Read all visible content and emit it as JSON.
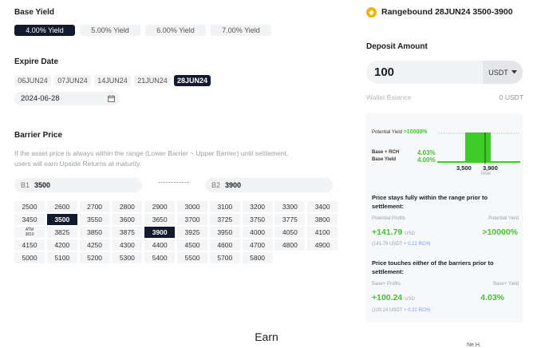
{
  "base_yield": {
    "title": "Base Yield",
    "options": [
      "4.00% Yield",
      "5.00% Yield",
      "6.00% Yield",
      "7.00% Yield"
    ],
    "selected": 0
  },
  "expire": {
    "title": "Expire Date",
    "dates": [
      "06JUN24",
      "07JUN24",
      "14JUN24",
      "21JUN24",
      "28JUN24"
    ],
    "selected": 4,
    "date_value": "2024-06-28"
  },
  "barrier": {
    "title": "Barrier Price",
    "description_1": "If the asset price is always within the range (Lower Barrier ~ Upper Barrier) until settlement,",
    "description_2": "users will earn Upside Returns at maturity.",
    "b1_label": "B1",
    "b1_value": "3500",
    "b2_label": "B2",
    "b2_value": "3900",
    "atm_label": "ATM",
    "atm_value": "3810",
    "prices": [
      "2500",
      "2600",
      "2700",
      "2800",
      "2900",
      "3000",
      "3100",
      "3200",
      "3300",
      "3400",
      "3450",
      "3500",
      "3550",
      "3600",
      "3650",
      "3700",
      "3725",
      "3750",
      "3775",
      "3800",
      "ATM",
      "3825",
      "3850",
      "3875",
      "3900",
      "3925",
      "3950",
      "4000",
      "4050",
      "4100",
      "4150",
      "4200",
      "4250",
      "4300",
      "4400",
      "4500",
      "4600",
      "4700",
      "4800",
      "4900",
      "5000",
      "5100",
      "5200",
      "5300",
      "5400",
      "5500",
      "5700",
      "5800",
      "",
      ""
    ],
    "selected": [
      "3500",
      "3900"
    ]
  },
  "footer": {
    "earn": "Earn",
    "corner": "Ne.H."
  },
  "product": {
    "title": "Rangebound 28JUN24 3500-3900",
    "logo_glyph": "◆"
  },
  "deposit": {
    "title": "Deposit Amount",
    "amount": "100",
    "currency": "USDT",
    "wallet_label": "Wallet Balance",
    "wallet_value": "0 USDT"
  },
  "chart": {
    "potential_yield_label": "Potential Yield",
    "potential_yield_value": ">10000%",
    "base_rch_label": "Base + RCH",
    "base_rch_value": "4.03%",
    "base_yield_label": "Base Yield",
    "base_yield_value": "4.00%",
    "tick_left": "3,500",
    "tick_right": "3,900",
    "tick_now": "Now"
  },
  "scenario_within": {
    "heading_1": "Price stays fully within the range prior to",
    "heading_2": "settlement:",
    "profits_label": "Potential Profits",
    "profits_value": "+141.79",
    "profits_unit": "USD",
    "yield_label": "Potential Yield",
    "yield_value": ">10000%",
    "breakdown_1": "(141.79 USDT +",
    "breakdown_2": "0.22 RCH)"
  },
  "scenario_touch": {
    "heading_1": "Price touches either of the barriers prior to",
    "heading_2": "settlement:",
    "profits_label": "Base+ Profits",
    "profits_value": "+100.24",
    "profits_unit": "USD",
    "yield_label": "Base+ Yield",
    "yield_value": "4.03%",
    "breakdown_1": "(100.24 USDT +",
    "breakdown_2": "0.22 RCH)"
  },
  "colors": {
    "dark": "#141a2e",
    "green": "#47c033",
    "chart_green": "#3dcc28"
  }
}
